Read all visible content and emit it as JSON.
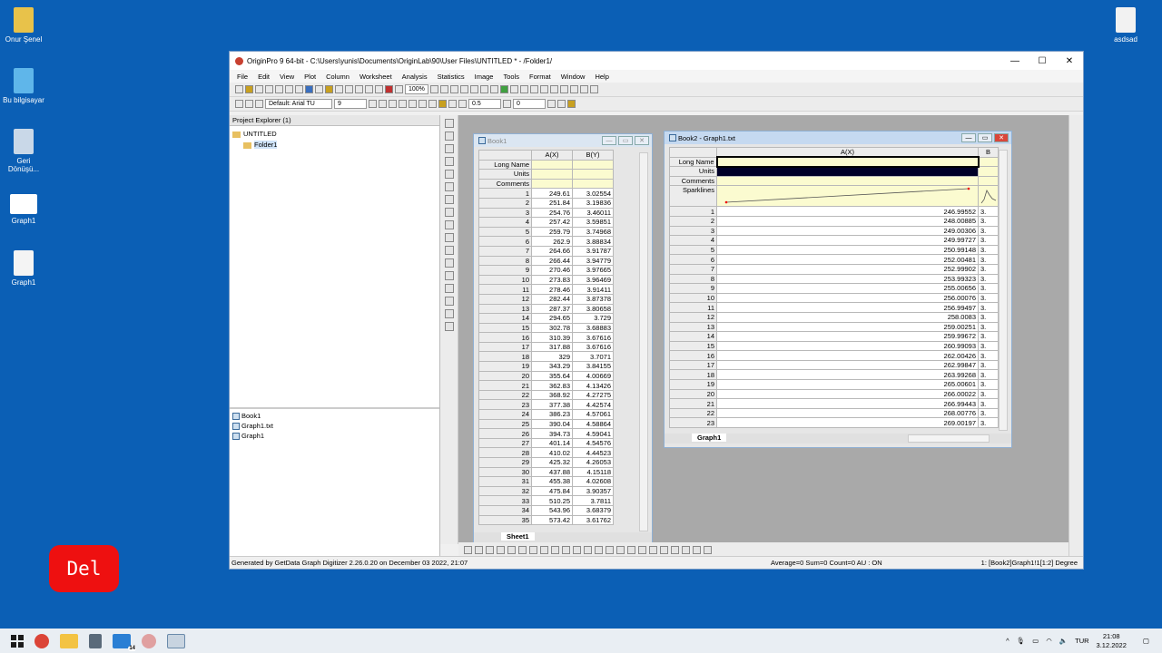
{
  "desktop": {
    "icons": [
      {
        "label": "Onur Şenel",
        "icon": "user-folder-icon"
      },
      {
        "label": "Bu bilgisayar",
        "icon": "computer-icon"
      },
      {
        "label": "Geri\nDönüşü...",
        "icon": "recycle-bin-icon"
      },
      {
        "label": "Graph1",
        "icon": "image-file-icon"
      },
      {
        "label": "Graph1",
        "icon": "document-icon"
      }
    ],
    "right_icon": {
      "label": "asdsad",
      "icon": "folder-icon"
    }
  },
  "window": {
    "title": "OriginPro 9 64-bit - C:\\Users\\yunis\\Documents\\OriginLab\\90\\User Files\\UNTITLED * - /Folder1/",
    "min": "—",
    "max": "☐",
    "close": "✕"
  },
  "menu": [
    "File",
    "Edit",
    "View",
    "Plot",
    "Column",
    "Worksheet",
    "Analysis",
    "Statistics",
    "Image",
    "Tools",
    "Format",
    "Window",
    "Help"
  ],
  "toolbar": {
    "zoom": "100%",
    "font": "Default: Arial TU",
    "size": "9",
    "linewidth": "0.5",
    "offset": "0"
  },
  "project_explorer": {
    "title": "Project Explorer (1)",
    "root": "UNTITLED",
    "folder": "Folder1",
    "items": [
      "Book1",
      "Graph1.txt",
      "Graph1"
    ]
  },
  "book1": {
    "title": "Book1",
    "cols": [
      "A(X)",
      "B(Y)"
    ],
    "labels": [
      "Long Name",
      "Units",
      "Comments"
    ],
    "sheet": "Sheet1",
    "rows": [
      [
        "249.61",
        "3.02554"
      ],
      [
        "251.84",
        "3.19836"
      ],
      [
        "254.76",
        "3.46011"
      ],
      [
        "257.42",
        "3.59851"
      ],
      [
        "259.79",
        "3.74968"
      ],
      [
        "262.9",
        "3.88834"
      ],
      [
        "264.66",
        "3.91787"
      ],
      [
        "266.44",
        "3.94779"
      ],
      [
        "270.46",
        "3.97665"
      ],
      [
        "273.83",
        "3.96469"
      ],
      [
        "278.46",
        "3.91411"
      ],
      [
        "282.44",
        "3.87378"
      ],
      [
        "287.37",
        "3.80658"
      ],
      [
        "294.65",
        "3.729"
      ],
      [
        "302.78",
        "3.68883"
      ],
      [
        "310.39",
        "3.67616"
      ],
      [
        "317.88",
        "3.67616"
      ],
      [
        "329",
        "3.7071"
      ],
      [
        "343.29",
        "3.84155"
      ],
      [
        "355.64",
        "4.00669"
      ],
      [
        "362.83",
        "4.13426"
      ],
      [
        "368.92",
        "4.27275"
      ],
      [
        "377.38",
        "4.42574"
      ],
      [
        "386.23",
        "4.57061"
      ],
      [
        "390.04",
        "4.58864"
      ],
      [
        "394.73",
        "4.59041"
      ],
      [
        "401.14",
        "4.54576"
      ],
      [
        "410.02",
        "4.44523"
      ],
      [
        "425.32",
        "4.26053"
      ],
      [
        "437.88",
        "4.15118"
      ],
      [
        "455.38",
        "4.02608"
      ],
      [
        "475.84",
        "3.90357"
      ],
      [
        "510.25",
        "3.7811"
      ],
      [
        "543.96",
        "3.68379"
      ],
      [
        "573.42",
        "3.61762"
      ]
    ]
  },
  "book2": {
    "title": "Book2 - Graph1.txt",
    "cols": [
      "A(X)",
      "B"
    ],
    "labels": [
      "Long Name",
      "Units",
      "Comments",
      "Sparklines"
    ],
    "sheet": "Graph1",
    "rows": [
      "246.99552",
      "248.00885",
      "249.00306",
      "249.99727",
      "250.99148",
      "252.00481",
      "252.99902",
      "253.99323",
      "255.00656",
      "256.00076",
      "256.99497",
      "258.0083",
      "259.00251",
      "259.99672",
      "260.99093",
      "262.00426",
      "262.99847",
      "263.99268",
      "265.00601",
      "266.00022",
      "266.99443",
      "268.00776",
      "269.00197"
    ],
    "bcol": "3."
  },
  "status": {
    "left": "Generated by GetData Graph Digitizer 2.26.0.20 on December 03 2022, 21:07",
    "mid": "Average=0 Sum=0 Count=0  AU : ON",
    "right": "1: [Book2]Graph1!1[1:2]   Degree"
  },
  "taskbar": {
    "lang": "TUR",
    "time": "21:08",
    "date": "3.12.2022",
    "badge": "14"
  },
  "overlay": {
    "key": "Del"
  }
}
